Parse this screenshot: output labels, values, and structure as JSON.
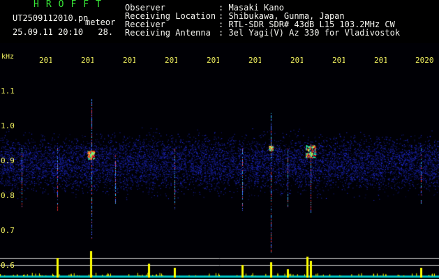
{
  "header": {
    "brand": "HROFFT",
    "filename": "UT2509112010.pn",
    "meteor_label": "meteor",
    "datetime": "25.09.11 20:10",
    "count": "28.",
    "fields": [
      {
        "label": "Observer",
        "value": ": Masaki Kano"
      },
      {
        "label": "Receiving Location",
        "value": ": Shibukawa, Gunma, Japan"
      },
      {
        "label": "Receiver",
        "value": ": RTL-SDR SDR# 43dB L15 103.2MHz CW"
      },
      {
        "label": "Receiving Antenna",
        "value": ": 3el Yagi(V) Az 330 for Vladivostok"
      }
    ]
  },
  "colors": {
    "accent_brand": "#38e838",
    "axis_text": "#f0f060",
    "header_text": "#f5f5f0",
    "power_bars": "#ffff00",
    "baseline": "#00c8c8"
  },
  "spectrogram": {
    "unit_label": "kHz",
    "y_labels": [
      "1.1",
      "1.0",
      "0.9",
      "0.8",
      "0.7",
      "0.6"
    ],
    "time_labels": [
      "201",
      "201",
      "201",
      "201",
      "201",
      "201",
      "201",
      "201",
      "201",
      "2020"
    ],
    "vertical_scale": "1.4 dB"
  }
}
